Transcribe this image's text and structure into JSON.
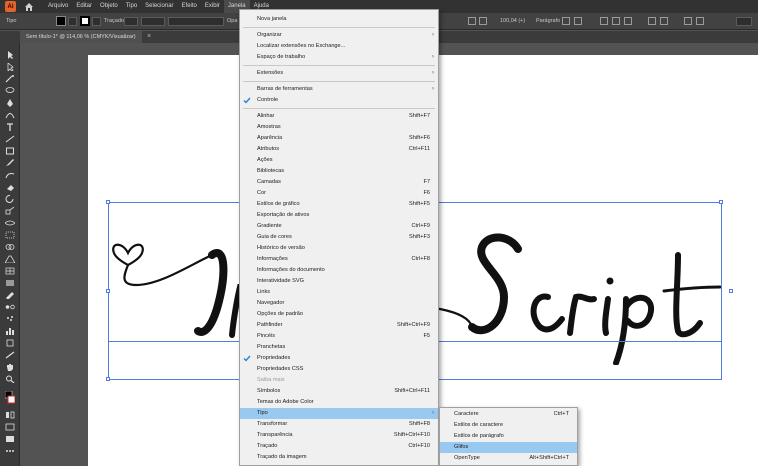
{
  "app": {
    "logo_text": "Ai",
    "menu": [
      "Arquivo",
      "Editar",
      "Objeto",
      "Tipo",
      "Selecionar",
      "Efeito",
      "Exibir",
      "Janela",
      "Ajuda"
    ],
    "active_menu": "Janela"
  },
  "control_bar": {
    "label_tipo": "Tipo",
    "stroke_label": "Traçado",
    "opacity_label": "Opa",
    "zoom_value": "100,04 (+)",
    "paragraph_label": "Parágrafo"
  },
  "document": {
    "tab_title": "Sem título-1* @ 114,06 % (CMYK/Visualizar)",
    "close_glyph": "×"
  },
  "window_menu": {
    "items": [
      {
        "label": "Nova janela",
        "shortcut": "",
        "submenu": false,
        "checked": false,
        "disabled": false,
        "highlight": false
      },
      {
        "sep": true
      },
      {
        "label": "Organizar",
        "shortcut": "",
        "submenu": true,
        "checked": false,
        "disabled": false,
        "highlight": false
      },
      {
        "label": "Localizar extensões no Exchange...",
        "shortcut": "",
        "submenu": false,
        "checked": false,
        "disabled": false,
        "highlight": false
      },
      {
        "label": "Espaço de trabalho",
        "shortcut": "",
        "submenu": true,
        "checked": false,
        "disabled": false,
        "highlight": false
      },
      {
        "sep": true
      },
      {
        "label": "Extensões",
        "shortcut": "",
        "submenu": true,
        "checked": false,
        "disabled": false,
        "highlight": false
      },
      {
        "sep": true
      },
      {
        "label": "Barras de ferramentas",
        "shortcut": "",
        "submenu": true,
        "checked": false,
        "disabled": false,
        "highlight": false
      },
      {
        "label": "Controle",
        "shortcut": "",
        "submenu": false,
        "checked": true,
        "disabled": false,
        "highlight": false
      },
      {
        "sep": true
      },
      {
        "label": "Alinhar",
        "shortcut": "Shift+F7",
        "submenu": false,
        "checked": false,
        "disabled": false,
        "highlight": false
      },
      {
        "label": "Amostras",
        "shortcut": "",
        "submenu": false,
        "checked": false,
        "disabled": false,
        "highlight": false
      },
      {
        "label": "Aparência",
        "shortcut": "Shift+F6",
        "submenu": false,
        "checked": false,
        "disabled": false,
        "highlight": false
      },
      {
        "label": "Atributos",
        "shortcut": "Ctrl+F11",
        "submenu": false,
        "checked": false,
        "disabled": false,
        "highlight": false
      },
      {
        "label": "Ações",
        "shortcut": "",
        "submenu": false,
        "checked": false,
        "disabled": false,
        "highlight": false
      },
      {
        "label": "Bibliotecas",
        "shortcut": "",
        "submenu": false,
        "checked": false,
        "disabled": false,
        "highlight": false
      },
      {
        "label": "Camadas",
        "shortcut": "F7",
        "submenu": false,
        "checked": false,
        "disabled": false,
        "highlight": false
      },
      {
        "label": "Cor",
        "shortcut": "F6",
        "submenu": false,
        "checked": false,
        "disabled": false,
        "highlight": false
      },
      {
        "label": "Estilos de gráfico",
        "shortcut": "Shift+F5",
        "submenu": false,
        "checked": false,
        "disabled": false,
        "highlight": false
      },
      {
        "label": "Exportação de ativos",
        "shortcut": "",
        "submenu": false,
        "checked": false,
        "disabled": false,
        "highlight": false
      },
      {
        "label": "Gradiente",
        "shortcut": "Ctrl+F9",
        "submenu": false,
        "checked": false,
        "disabled": false,
        "highlight": false
      },
      {
        "label": "Guia de cores",
        "shortcut": "Shift+F3",
        "submenu": false,
        "checked": false,
        "disabled": false,
        "highlight": false
      },
      {
        "label": "Histórico de versão",
        "shortcut": "",
        "submenu": false,
        "checked": false,
        "disabled": false,
        "highlight": false
      },
      {
        "label": "Informações",
        "shortcut": "Ctrl+F8",
        "submenu": false,
        "checked": false,
        "disabled": false,
        "highlight": false
      },
      {
        "label": "Informações do documento",
        "shortcut": "",
        "submenu": false,
        "checked": false,
        "disabled": false,
        "highlight": false
      },
      {
        "label": "Interatividade SVG",
        "shortcut": "",
        "submenu": false,
        "checked": false,
        "disabled": false,
        "highlight": false
      },
      {
        "label": "Links",
        "shortcut": "",
        "submenu": false,
        "checked": false,
        "disabled": false,
        "highlight": false
      },
      {
        "label": "Navegador",
        "shortcut": "",
        "submenu": false,
        "checked": false,
        "disabled": false,
        "highlight": false
      },
      {
        "label": "Opções de padrão",
        "shortcut": "",
        "submenu": false,
        "checked": false,
        "disabled": false,
        "highlight": false
      },
      {
        "label": "Pathfinder",
        "shortcut": "Shift+Ctrl+F9",
        "submenu": false,
        "checked": false,
        "disabled": false,
        "highlight": false
      },
      {
        "label": "Pincéis",
        "shortcut": "F5",
        "submenu": false,
        "checked": false,
        "disabled": false,
        "highlight": false
      },
      {
        "label": "Pranchetas",
        "shortcut": "",
        "submenu": false,
        "checked": false,
        "disabled": false,
        "highlight": false
      },
      {
        "label": "Propriedades",
        "shortcut": "",
        "submenu": false,
        "checked": true,
        "disabled": false,
        "highlight": false
      },
      {
        "label": "Propriedades CSS",
        "shortcut": "",
        "submenu": false,
        "checked": false,
        "disabled": false,
        "highlight": false
      },
      {
        "label": "Saiba mais",
        "shortcut": "",
        "submenu": false,
        "checked": false,
        "disabled": true,
        "highlight": false
      },
      {
        "label": "Símbolos",
        "shortcut": "Shift+Ctrl+F11",
        "submenu": false,
        "checked": false,
        "disabled": false,
        "highlight": false
      },
      {
        "label": "Temas do Adobe Color",
        "shortcut": "",
        "submenu": false,
        "checked": false,
        "disabled": false,
        "highlight": false
      },
      {
        "label": "Tipo",
        "shortcut": "",
        "submenu": true,
        "checked": false,
        "disabled": false,
        "highlight": true
      },
      {
        "label": "Transformar",
        "shortcut": "Shift+F8",
        "submenu": false,
        "checked": false,
        "disabled": false,
        "highlight": false
      },
      {
        "label": "Transparência",
        "shortcut": "Shift+Ctrl+F10",
        "submenu": false,
        "checked": false,
        "disabled": false,
        "highlight": false
      },
      {
        "label": "Traçado",
        "shortcut": "Ctrl+F10",
        "submenu": false,
        "checked": false,
        "disabled": false,
        "highlight": false
      },
      {
        "label": "Traçado da imagem",
        "shortcut": "",
        "submenu": false,
        "checked": false,
        "disabled": false,
        "highlight": false
      }
    ]
  },
  "type_submenu": {
    "items": [
      {
        "label": "Caractere",
        "shortcut": "Ctrl+T",
        "highlight": false
      },
      {
        "label": "Estilos de caractere",
        "shortcut": "",
        "highlight": false
      },
      {
        "label": "Estilos de parágrafo",
        "shortcut": "",
        "highlight": false
      },
      {
        "label": "Glifos",
        "shortcut": "",
        "highlight": true
      },
      {
        "label": "OpenType",
        "shortcut": "Alt+Shift+Ctrl+T",
        "highlight": false
      }
    ]
  },
  "colors": {
    "menu_highlight": "#99c8f0",
    "selection": "#4f7de0",
    "app_accent": "#e0642c",
    "check": "#2f7fd6"
  }
}
